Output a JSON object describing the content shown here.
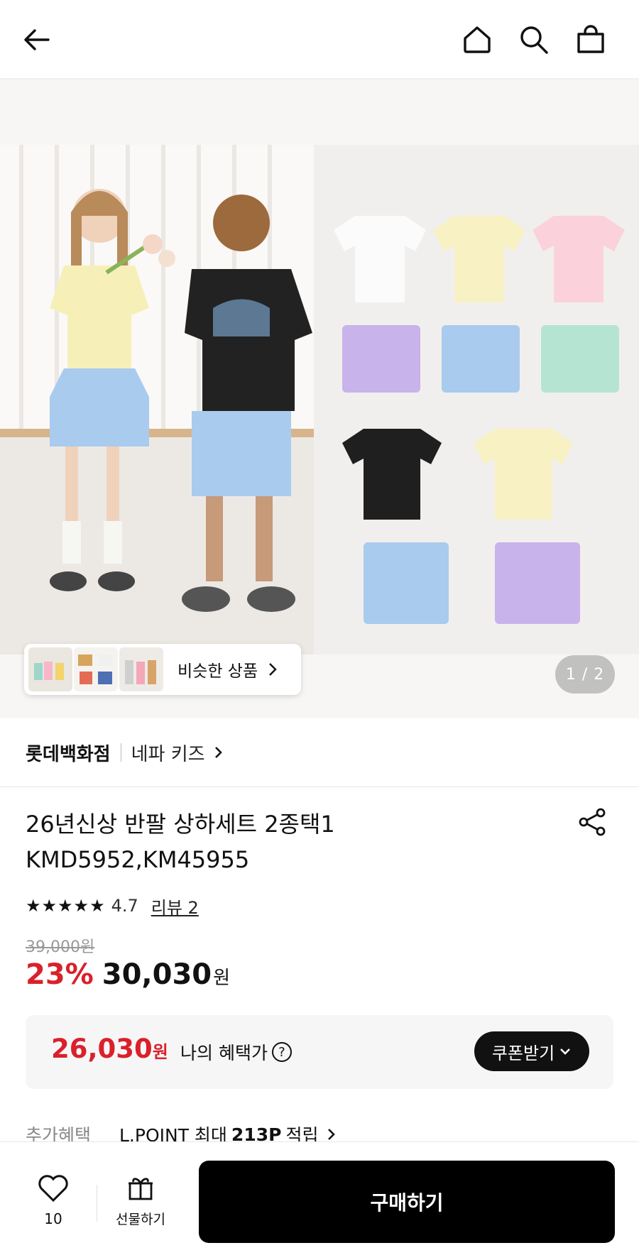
{
  "header": {
    "back_icon": "arrow-left-icon",
    "home_icon": "home-icon",
    "search_icon": "search-icon",
    "cart_icon": "shopping-bag-icon"
  },
  "gallery": {
    "similar_label": "비슷한 상품",
    "counter": "1 / 2"
  },
  "brand": {
    "store": "롯데백화점",
    "name": "네파 키즈"
  },
  "product": {
    "title_line1": "26년신상 반팔 상하세트 2종택1",
    "title_line2": "KMD5952,KM45955",
    "rating": "4.7",
    "review": "리뷰 2",
    "original_price": "39,000원",
    "discount": "23%",
    "price": "30,030",
    "price_unit": "원"
  },
  "benefit": {
    "price": "26,030",
    "price_unit": "원",
    "label": "나의 혜택가",
    "help": "?",
    "coupon_button": "쿠폰받기"
  },
  "extra": {
    "label": "추가혜택",
    "text_prefix": "L.POINT 최대",
    "points": "213P",
    "text_suffix": "적립"
  },
  "bottom": {
    "like_count": "10",
    "gift_label": "선물하기",
    "buy_label": "구매하기"
  },
  "colors": {
    "accent_red": "#d9212b",
    "buy_button": "#000000"
  }
}
